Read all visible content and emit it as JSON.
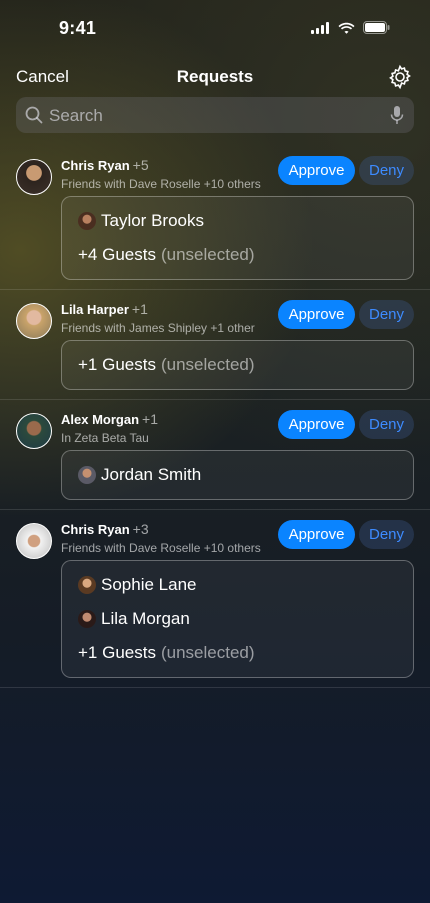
{
  "status": {
    "time": "9:41"
  },
  "nav": {
    "cancel": "Cancel",
    "title": "Requests"
  },
  "search": {
    "placeholder": "Search"
  },
  "buttons": {
    "approve": "Approve",
    "deny": "Deny"
  },
  "requests": [
    {
      "name": "Chris Ryan",
      "count": "+5",
      "subtitle": "Friends with Dave Roselle +10 others",
      "guests": [
        "Taylor Brooks"
      ],
      "extra": {
        "count": "+4 Guests",
        "note": "(unselected)"
      }
    },
    {
      "name": "Lila Harper",
      "count": "+1",
      "subtitle": "Friends with James Shipley +1 other",
      "guests": [],
      "extra": {
        "count": "+1 Guests",
        "note": "(unselected)"
      }
    },
    {
      "name": "Alex Morgan",
      "count": "+1",
      "subtitle": "In Zeta Beta Tau",
      "guests": [
        "Jordan Smith"
      ]
    },
    {
      "name": "Chris Ryan",
      "count": "+3",
      "subtitle": "Friends with Dave Roselle +10 others",
      "guests": [
        "Sophie Lane",
        "Lila Morgan"
      ],
      "extra": {
        "count": "+1 Guests",
        "note": "(unselected)"
      }
    }
  ],
  "colors": {
    "accent": "#0a84ff",
    "deny_text": "#3d8bff"
  },
  "icons": [
    "signal-icon",
    "wifi-icon",
    "battery-icon",
    "gear-icon",
    "search-icon",
    "mic-icon"
  ]
}
